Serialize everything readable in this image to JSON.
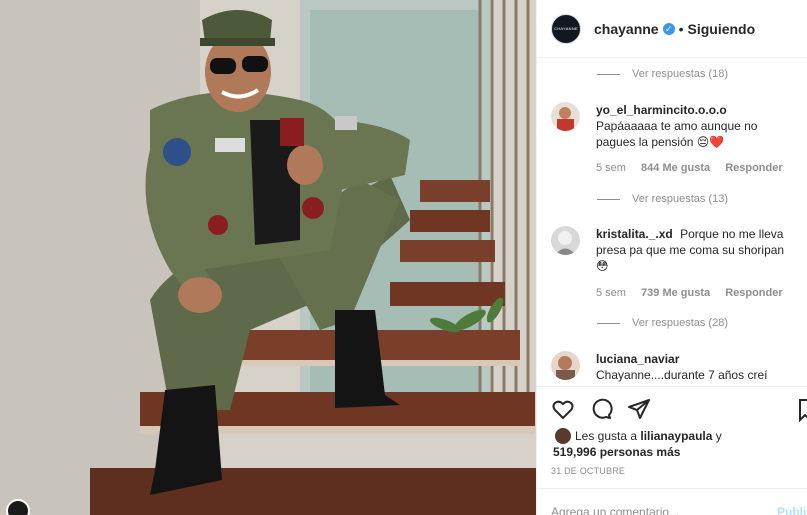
{
  "header": {
    "avatar_text": "CHAYANNE",
    "username": "chayanne",
    "verified_mark": "✓",
    "separator": "•",
    "follow_status": "Siguiendo"
  },
  "comments": {
    "view_replies_1": "Ver respuestas (18)",
    "items": [
      {
        "username": "yo_el_harmincito.o.o.o",
        "text": "Papáaaaaa te amo aunque no pagues la pensión 😔❤️",
        "time": "5 sem",
        "likes": "844 Me gusta",
        "reply": "Responder"
      },
      {
        "username": "kristalita._.xd",
        "text": "Porque no me lleva presa pa que me coma su shoripan 😳",
        "time": "5 sem",
        "likes": "739 Me gusta",
        "reply": "Responder"
      },
      {
        "username": "luciana_naviar",
        "text": "Chayanne....durante 7 años creí"
      }
    ],
    "view_replies_2": "Ver respuestas (13)",
    "view_replies_3": "Ver respuestas (28)",
    "heart_icon_glyph": "♡"
  },
  "actions": {
    "icons": [
      "heart-icon",
      "comment-icon",
      "share-icon",
      "bookmark-icon"
    ],
    "liked_by_prefix": "Les gusta a ",
    "liked_by_user": "lilianaypaula",
    "liked_by_suffix": " y",
    "likes_count": "519,996 personas más",
    "date": "31 DE OCTUBRE"
  },
  "add_comment": {
    "placeholder": "Agrega un comentario...",
    "publish_label": "Publicar"
  },
  "colors": {
    "accent": "#3897f0",
    "muted": "#8e8e8e",
    "publish_disabled": "#b2dffc"
  }
}
